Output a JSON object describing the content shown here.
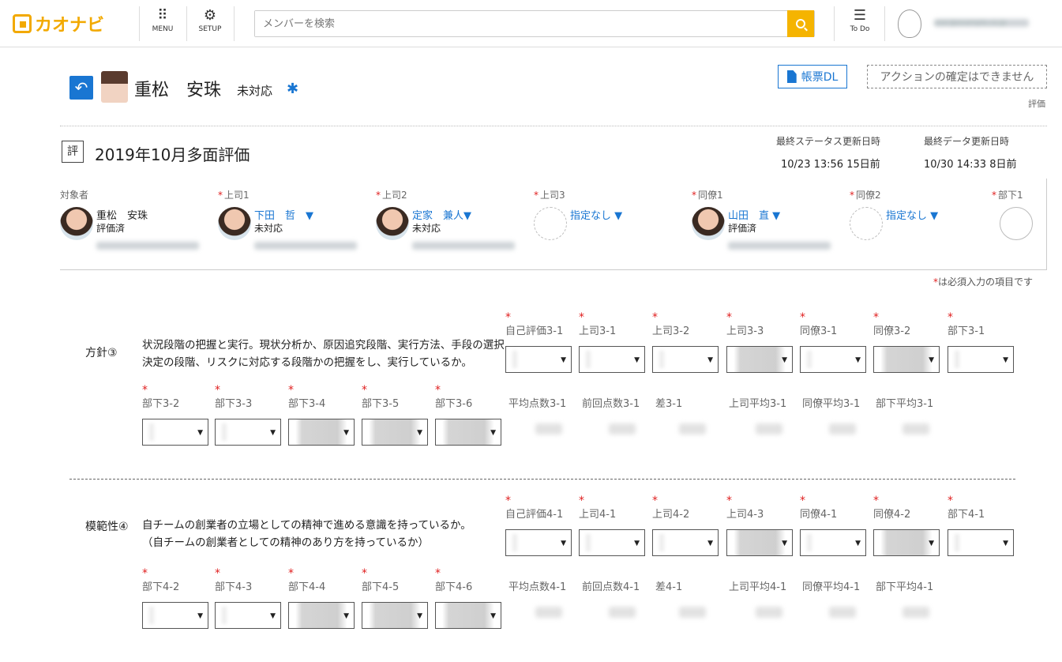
{
  "topbar": {
    "logo_text": "カオナビ",
    "menu_label": "MENU",
    "setup_label": "SETUP",
    "search_placeholder": "メンバーを検索",
    "todo_label": "To Do",
    "user_email": "user@example.co.jp"
  },
  "header": {
    "name": "重松　安珠",
    "status": "未対応",
    "download_label": "帳票DL",
    "action_notice": "アクションの確定はできません",
    "eval_label": "評価"
  },
  "evaluation": {
    "icon_char": "評",
    "title": "2019年10月多面評価",
    "status_updated_label": "最終ステータス更新日時",
    "status_updated_value": "10/23 13:56 15日前",
    "data_updated_label": "最終データ更新日時",
    "data_updated_value": "10/30 14:33 8日前"
  },
  "evaluators": [
    {
      "role": "対象者",
      "required": false,
      "name": "重松　安珠",
      "status": "評価済",
      "link": false
    },
    {
      "role": "上司1",
      "required": true,
      "name": "下田　哲　▼",
      "status": "未対応",
      "link": true
    },
    {
      "role": "上司2",
      "required": true,
      "name": "定家　兼人▼",
      "status": "未対応",
      "link": true
    },
    {
      "role": "上司3",
      "required": true,
      "name": "指定なし ▼",
      "status": "",
      "link": true,
      "empty": true
    },
    {
      "role": "同僚1",
      "required": true,
      "name": "山田　直 ▼",
      "status": "評価済",
      "link": true
    },
    {
      "role": "同僚2",
      "required": true,
      "name": "指定なし ▼",
      "status": "",
      "link": true,
      "empty": true
    },
    {
      "role": "部下1",
      "required": true,
      "name": "",
      "status": "",
      "link": false
    }
  ],
  "required_note": "は必須入力の項目です",
  "sections": [
    {
      "name": "方針③",
      "description": "状況段階の把握と実行。現状分析か、原因追究段階、実行方法、手段の選択決定の段階、リスクに対応する段階かの把握をし、実行しているか。",
      "row1": [
        "自己評価3-1",
        "上司3-1",
        "上司3-2",
        "上司3-3",
        "同僚3-1",
        "同僚3-2",
        "部下3-1"
      ],
      "row2": [
        "部下3-2",
        "部下3-3",
        "部下3-4",
        "部下3-5",
        "部下3-6"
      ],
      "scores": [
        "平均点数3-1",
        "前回点数3-1",
        "差3-1",
        "上司平均3-1",
        "同僚平均3-1",
        "部下平均3-1"
      ]
    },
    {
      "name": "模範性④",
      "description": "自チームの創業者の立場としての精神で進める意識を持っているか。\n（自チームの創業者としての精神のあり方を持っているか）",
      "row1": [
        "自己評価4-1",
        "上司4-1",
        "上司4-2",
        "上司4-3",
        "同僚4-1",
        "同僚4-2",
        "部下4-1"
      ],
      "row2": [
        "部下4-2",
        "部下4-3",
        "部下4-4",
        "部下4-5",
        "部下4-6"
      ],
      "scores": [
        "平均点数4-1",
        "前回点数4-1",
        "差4-1",
        "上司平均4-1",
        "同僚平均4-1",
        "部下平均4-1"
      ]
    }
  ],
  "dropdown_arrow": "▼",
  "required_star": "*"
}
